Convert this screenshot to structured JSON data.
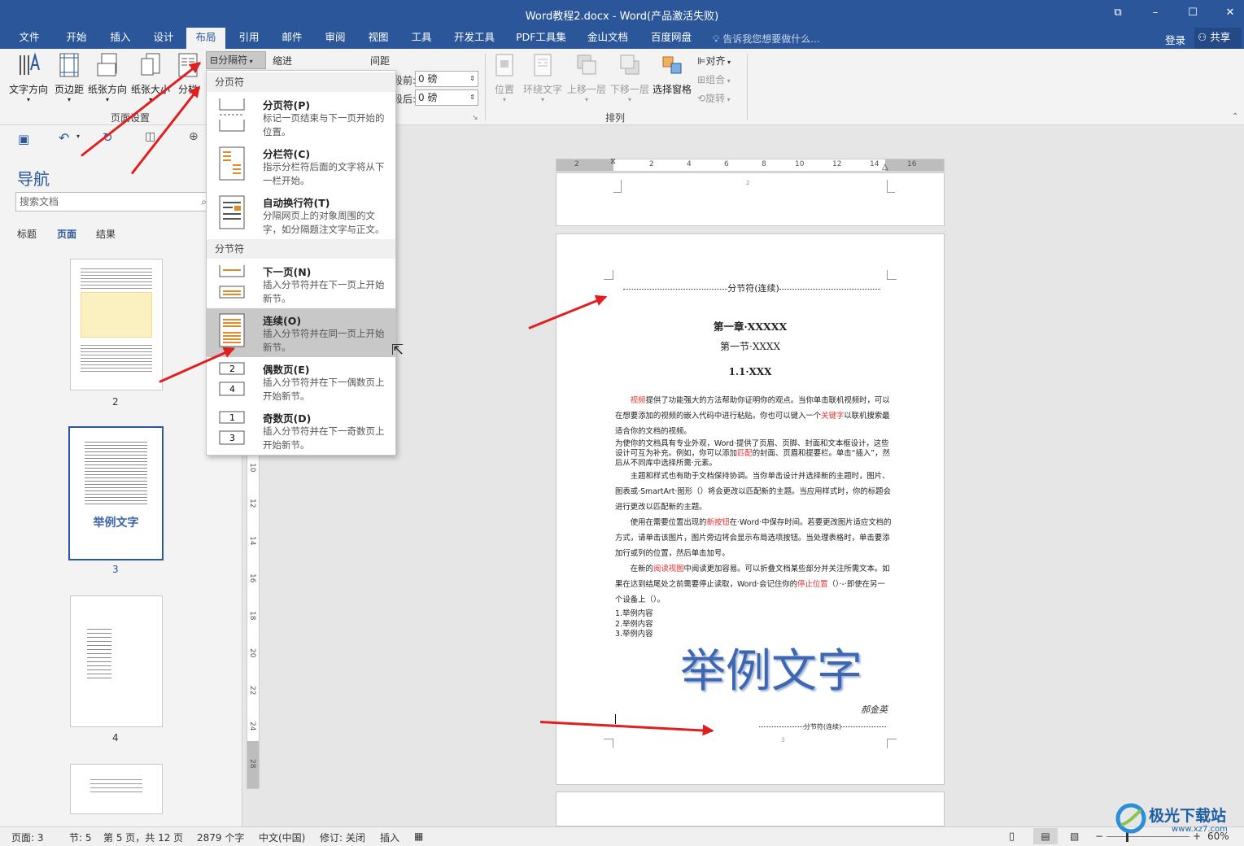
{
  "window": {
    "title": "Word教程2.docx - Word(产品激活失败)",
    "restore_icon": "⧉",
    "minimize": "–",
    "maximize": "☐",
    "close": "✕"
  },
  "tabs": [
    "文件",
    "开始",
    "插入",
    "设计",
    "布局",
    "引用",
    "邮件",
    "审阅",
    "视图",
    "工具",
    "开发工具",
    "PDF工具集",
    "金山文档",
    "百度网盘"
  ],
  "active_tab": "布局",
  "tellme": "告诉我您想要做什么...",
  "login": "登录",
  "share": "共享",
  "ribbon": {
    "page_setup": {
      "buttons": [
        "文字方向",
        "页边距",
        "纸张方向",
        "纸张大小",
        "分栏"
      ],
      "group_label": "页面设置"
    },
    "breaks_button": "分隔符",
    "indent_label": "缩进",
    "spacing_label": "间距",
    "spacing_before_label": "段前:",
    "spacing_after_label": "段后:",
    "spacing_before_value": "0 磅",
    "spacing_after_value": "0 磅",
    "arrange": {
      "buttons": [
        "位置",
        "环绕文字",
        "上移一层",
        "下移一层",
        "选择窗格"
      ],
      "group_label": "排列"
    },
    "align_items": [
      "对齐",
      "组合",
      "旋转"
    ]
  },
  "nav": {
    "title": "导航",
    "search_placeholder": "搜索文档",
    "tabs": [
      "标题",
      "页面",
      "结果"
    ],
    "thumb_labels": [
      "2",
      "3",
      "4"
    ],
    "thumb_big_text": "举例文字"
  },
  "breaks_menu": {
    "section1": "分页符",
    "section2": "分节符",
    "items": [
      {
        "title": "分页符(P)",
        "desc": "标记一页结束与下一页开始的位置。"
      },
      {
        "title": "分栏符(C)",
        "desc": "指示分栏符后面的文字将从下一栏开始。"
      },
      {
        "title": "自动换行符(T)",
        "desc": "分隔网页上的对象周围的文字，如分隔题注文字与正文。"
      },
      {
        "title": "下一页(N)",
        "desc": "插入分节符并在下一页上开始新节。"
      },
      {
        "title": "连续(O)",
        "desc": "插入分节符并在同一页上开始新节。"
      },
      {
        "title": "偶数页(E)",
        "desc": "插入分节符并在下一偶数页上开始新节。"
      },
      {
        "title": "奇数页(D)",
        "desc": "插入分节符并在下一奇数页上开始新节。"
      }
    ],
    "selected": "连续(O)"
  },
  "ruler_h": [
    "2",
    "2",
    "4",
    "6",
    "8",
    "10",
    "12",
    "14",
    "16"
  ],
  "ruler_v": [
    "10",
    "12",
    "14",
    "16",
    "18",
    "20",
    "22",
    "24",
    "28"
  ],
  "document": {
    "prev_page_number": "2",
    "section_break_top": "分节符(连续)",
    "chapter": "第一章·XXXXX",
    "section": "第一节·XXXX",
    "subsection": "1.1·XXX",
    "paragraphs": [
      {
        "parts": [
          {
            "t": "视频",
            "red": true
          },
          {
            "t": "提供了功能强大的方法帮助你证明你的观点。当你单击联机视频时，可以在想要添加的视频的嵌入代码中进行粘贴。你也可以键入一个"
          },
          {
            "t": "关键字",
            "red": true
          },
          {
            "t": "以联机搜索最适合你的文档的视频。"
          }
        ],
        "indent": true,
        "lh": 19
      },
      {
        "parts": [
          {
            "t": "为使你的文档具有专业外观，Word·提供了页眉、页脚、封面和文本框设计，这些设计可互为补充。例如，你可以添加"
          },
          {
            "t": "匹配",
            "red": true
          },
          {
            "t": "的封面、页眉和提要栏。单击“插入”，然后从不同库中选择所需·元素。"
          }
        ],
        "indent": false,
        "lh": 12
      },
      {
        "parts": [
          {
            "t": "主题和样式也有助于文档保持协调。当你单击设计并选择新的主题时，图片、图表或·SmartArt·图形（）将会更改以匹配新的主题。当应用样式时，你的标题会进行更改以匹配新的主题。"
          }
        ],
        "indent": true,
        "lh": 19
      },
      {
        "parts": [
          {
            "t": "使用在需要位置出现的"
          },
          {
            "t": "新按钮",
            "red": true
          },
          {
            "t": "在·Word·中保存时间。若要更改图片适应文档的方式，请单击该图片，图片旁边将会显示布局选项按钮。当处理表格时，单击要添加行或列的位置，然后单击加号。"
          }
        ],
        "indent": true,
        "lh": 19
      },
      {
        "parts": [
          {
            "t": "在新的"
          },
          {
            "t": "阅读视图",
            "red": true
          },
          {
            "t": "中阅读更加容易。可以折叠文档某些部分并关注所需文本。如果在达到结尾处之前需要停止读取，Word·会记住你的"
          },
          {
            "t": "停止位置",
            "red": true
          },
          {
            "t": "（）·-·即使在另一个设备上（）。"
          }
        ],
        "indent": true,
        "lh": 19
      }
    ],
    "list_items": [
      "1.举例内容",
      "2.举例内容",
      "3.举例内容"
    ],
    "big_text": "举例文字",
    "signature": "郝金英",
    "section_break_bottom": "分节符(连续)",
    "page_number": "3"
  },
  "status": {
    "page": "页面: 3",
    "section": "节: 5",
    "pages": "第 5 页，共 12 页",
    "words": "2879 个字",
    "lang": "中文(中国)",
    "revision": "修订: 关闭",
    "insert": "插入",
    "zoom": "60%"
  },
  "watermark": {
    "name": "极光下载站",
    "url": "www.xz7.com"
  },
  "colors": {
    "brand": "#2b579a",
    "arrow": "#e02020",
    "selected_item": "#c8c8c8",
    "red_text": "#e53030"
  }
}
